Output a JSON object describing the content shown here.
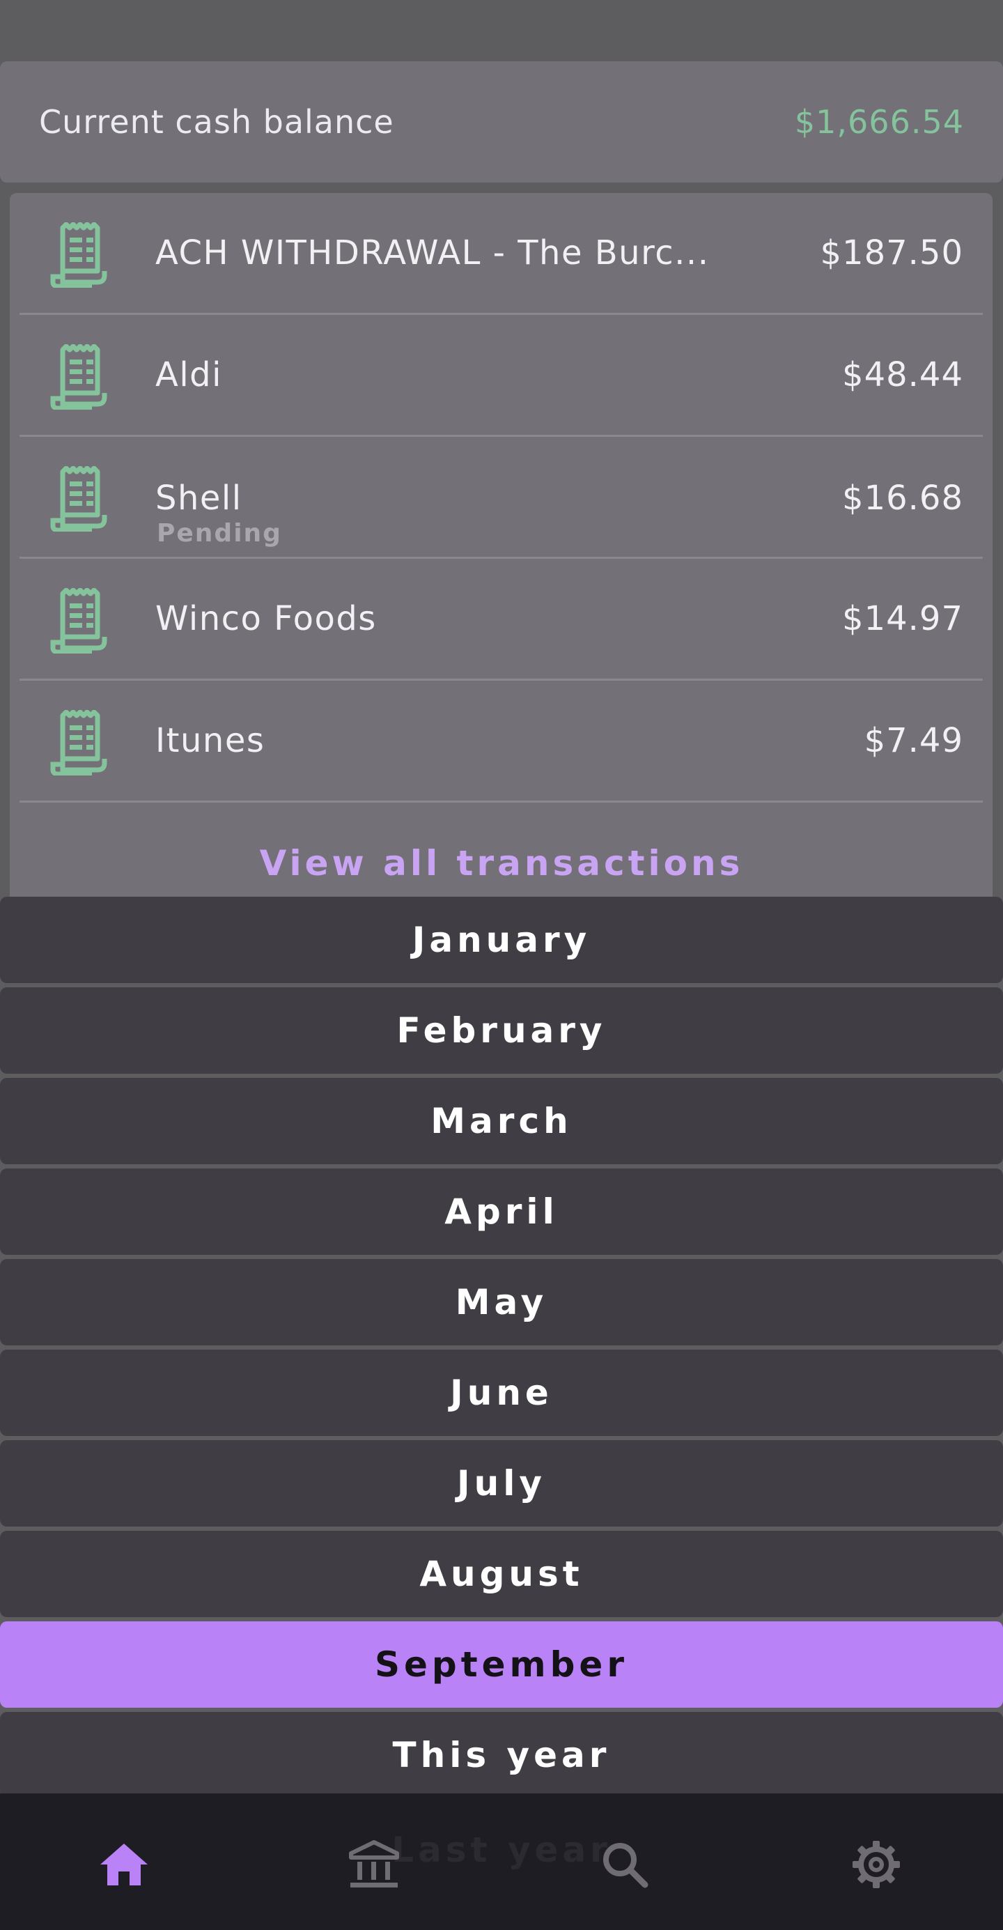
{
  "balance": {
    "label": "Current cash balance",
    "value": "$1,666.54",
    "value_color": "#84c39b"
  },
  "transactions": [
    {
      "icon": "receipt-icon",
      "name": "ACH WITHDRAWAL - The Burc...",
      "amount": "$187.50",
      "status": ""
    },
    {
      "icon": "receipt-icon",
      "name": "Aldi",
      "amount": "$48.44",
      "status": ""
    },
    {
      "icon": "receipt-icon",
      "name": "Shell",
      "amount": "$16.68",
      "status": "Pending"
    },
    {
      "icon": "receipt-icon",
      "name": "Winco Foods",
      "amount": "$14.97",
      "status": ""
    },
    {
      "icon": "receipt-icon",
      "name": "Itunes",
      "amount": "$7.49",
      "status": ""
    }
  ],
  "view_all_label": "View all transactions",
  "period_picker": {
    "options": [
      "January",
      "February",
      "March",
      "April",
      "May",
      "June",
      "July",
      "August",
      "September",
      "This year"
    ],
    "selected": "September",
    "hidden_options": [
      "Last year"
    ],
    "accent_color": "#b983f7"
  },
  "bottom_nav": {
    "items": [
      {
        "icon": "home-icon",
        "active": true
      },
      {
        "icon": "bank-icon",
        "active": false
      },
      {
        "icon": "search-icon",
        "active": false
      },
      {
        "icon": "gear-icon",
        "active": false
      }
    ]
  }
}
